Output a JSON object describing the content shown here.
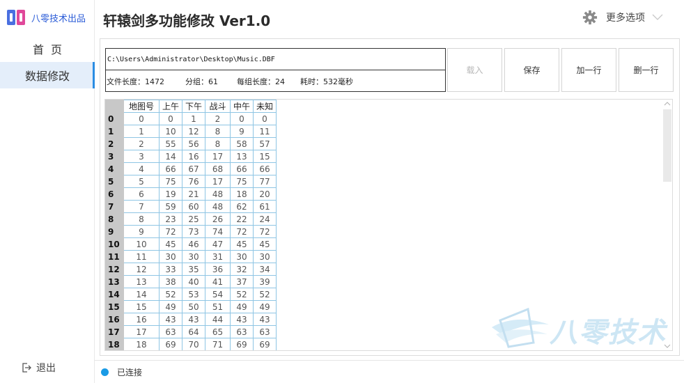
{
  "brand": {
    "text": "八零技术出品"
  },
  "app": {
    "title": "轩辕剑多功能修改  Ver1.0"
  },
  "header": {
    "more_label": "更多选项"
  },
  "nav": {
    "home": "首页",
    "data_edit": "数据修改",
    "logout": "退出"
  },
  "file": {
    "path": "C:\\Users\\Administrator\\Desktop\\Music.DBF",
    "length_label": "文件长度：1472",
    "group_label": "分组：61",
    "group_length_label": "每组长度：24",
    "time_label": "耗时：532毫秒"
  },
  "toolbar": {
    "load": "载入",
    "save": "保存",
    "add_row": "加一行",
    "delete_row": "删一行"
  },
  "grid": {
    "columns": [
      "地图号",
      "上午",
      "下午",
      "战斗",
      "中午",
      "未知"
    ],
    "rows": [
      {
        "id": "0",
        "cells": [
          "0",
          "0",
          "1",
          "2",
          "0",
          "0"
        ]
      },
      {
        "id": "1",
        "cells": [
          "1",
          "10",
          "12",
          "8",
          "9",
          "11"
        ]
      },
      {
        "id": "2",
        "cells": [
          "2",
          "55",
          "56",
          "8",
          "58",
          "57"
        ]
      },
      {
        "id": "3",
        "cells": [
          "3",
          "14",
          "16",
          "17",
          "13",
          "15"
        ]
      },
      {
        "id": "4",
        "cells": [
          "4",
          "66",
          "67",
          "68",
          "66",
          "66"
        ]
      },
      {
        "id": "5",
        "cells": [
          "5",
          "75",
          "76",
          "17",
          "75",
          "77"
        ]
      },
      {
        "id": "6",
        "cells": [
          "6",
          "19",
          "21",
          "48",
          "18",
          "20"
        ]
      },
      {
        "id": "7",
        "cells": [
          "7",
          "59",
          "60",
          "48",
          "62",
          "61"
        ]
      },
      {
        "id": "8",
        "cells": [
          "8",
          "23",
          "25",
          "26",
          "22",
          "24"
        ]
      },
      {
        "id": "9",
        "cells": [
          "9",
          "72",
          "73",
          "74",
          "72",
          "72"
        ]
      },
      {
        "id": "10",
        "cells": [
          "10",
          "45",
          "46",
          "47",
          "45",
          "45"
        ]
      },
      {
        "id": "11",
        "cells": [
          "11",
          "30",
          "30",
          "31",
          "30",
          "30"
        ]
      },
      {
        "id": "12",
        "cells": [
          "12",
          "33",
          "35",
          "36",
          "32",
          "34"
        ]
      },
      {
        "id": "13",
        "cells": [
          "13",
          "38",
          "40",
          "41",
          "37",
          "39"
        ]
      },
      {
        "id": "14",
        "cells": [
          "14",
          "52",
          "53",
          "54",
          "52",
          "52"
        ]
      },
      {
        "id": "15",
        "cells": [
          "15",
          "49",
          "50",
          "51",
          "49",
          "49"
        ]
      },
      {
        "id": "16",
        "cells": [
          "16",
          "43",
          "43",
          "44",
          "43",
          "43"
        ]
      },
      {
        "id": "17",
        "cells": [
          "17",
          "63",
          "64",
          "65",
          "63",
          "63"
        ]
      },
      {
        "id": "18",
        "cells": [
          "18",
          "69",
          "70",
          "71",
          "69",
          "69"
        ]
      }
    ]
  },
  "watermark": {
    "text": "八零技术"
  },
  "status": {
    "text": "已连接",
    "color": "#1a9be6"
  },
  "colors": {
    "accent": "#2b8de3",
    "nav_active_bg": "#e4eefa",
    "grid_border": "#8ec5e4",
    "row_header_bg": "#c8c8c8"
  }
}
